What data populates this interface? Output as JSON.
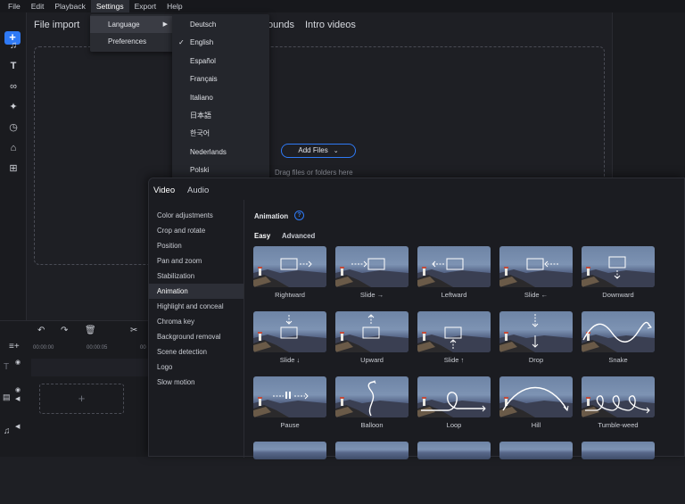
{
  "menubar": [
    "File",
    "Edit",
    "Playback",
    "Settings",
    "Export",
    "Help"
  ],
  "header": {
    "tab_import": "File import",
    "tab_sounds": "ounds",
    "tab_intro": "Intro videos"
  },
  "drop": {
    "add_files": "Add Files",
    "drag_text": "Drag files or folders here"
  },
  "settings_menu": {
    "language": "Language",
    "preferences": "Preferences"
  },
  "languages": [
    "Deutsch",
    "English",
    "Español",
    "Français",
    "Italiano",
    "日本語",
    "한국어",
    "Nederlands",
    "Polski"
  ],
  "selected_language": "English",
  "timeline": {
    "ticks": [
      "00:00:00",
      "00:00:05",
      "00"
    ]
  },
  "panel": {
    "tab_video": "Video",
    "tab_audio": "Audio",
    "sidebar": [
      "Color adjustments",
      "Crop and rotate",
      "Position",
      "Pan and zoom",
      "Stabilization",
      "Animation",
      "Highlight and conceal",
      "Chroma key",
      "Background removal",
      "Scene detection",
      "Logo",
      "Slow motion"
    ],
    "selected": "Animation",
    "title": "Animation",
    "sub_easy": "Easy",
    "sub_advanced": "Advanced",
    "cards": [
      "Rightward",
      "Slide →",
      "Leftward",
      "Slide ←",
      "Downward",
      "Slide ↓",
      "Upward",
      "Slide ↑",
      "Drop",
      "Snake",
      "Pause",
      "Balloon",
      "Loop",
      "Hill",
      "Tumble-weed"
    ]
  },
  "colors": {
    "accent": "#2f7af5"
  }
}
